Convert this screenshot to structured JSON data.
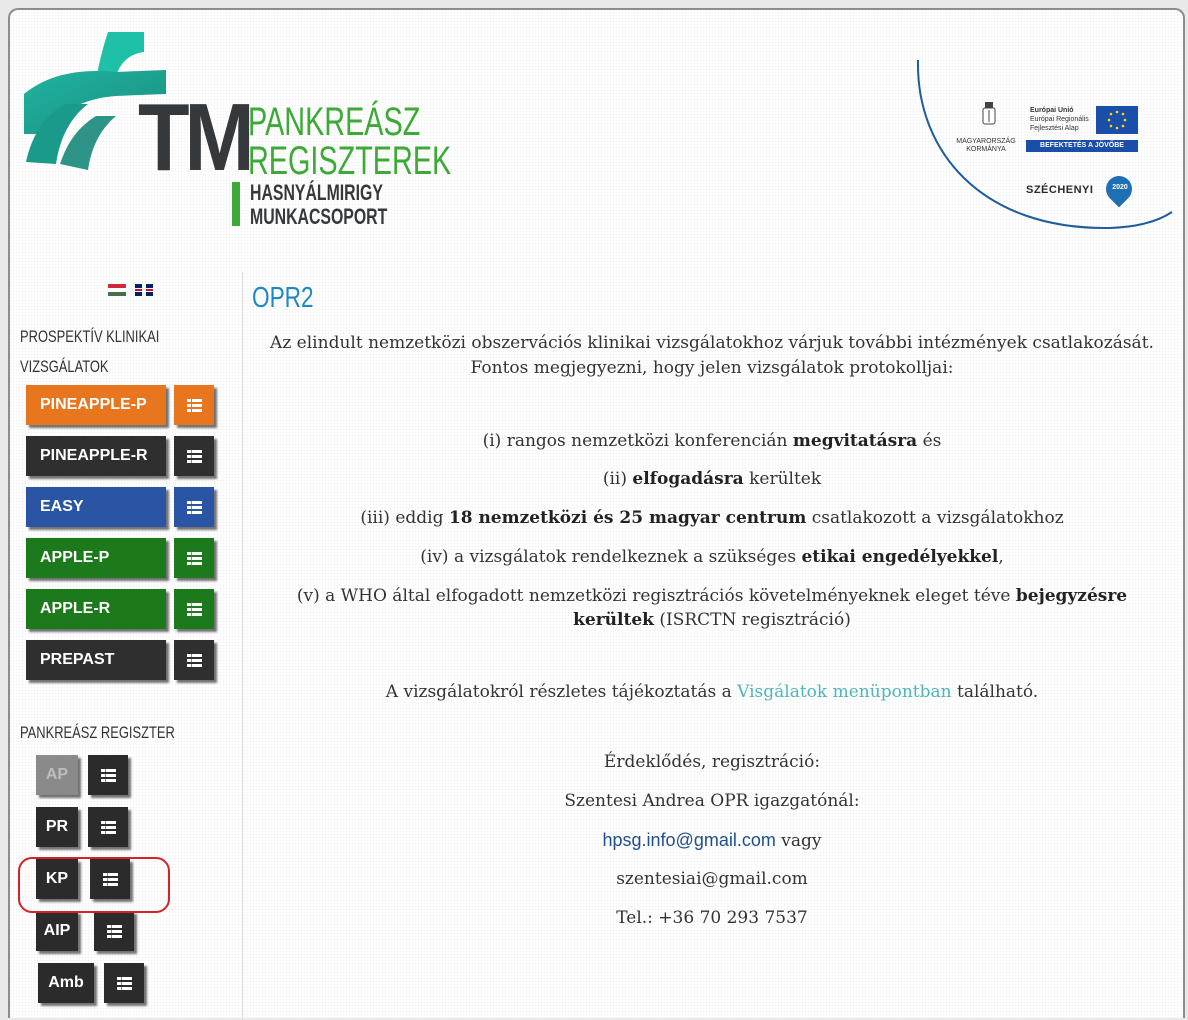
{
  "header": {
    "logo_letters": "TM",
    "logo_line1": "PANKREÁSZ",
    "logo_line2": "REGISZTEREK",
    "logo_sub1": "HASNYÁLMIRIGY",
    "logo_sub2": "MUNKACSOPORT",
    "badge": {
      "hu_text": "MAGYARORSZÁG KORMÁNYA",
      "eu_title": "Európai Unió",
      "eu_line2": "Európai Regionális",
      "eu_line3": "Fejlesztési Alap",
      "invest": "BEFEKTETÉS A JÖVŐBE",
      "szechenyi": "SZÉCHENYI",
      "year": "2020"
    }
  },
  "sidebar": {
    "section1_title_line1": "PROSPEKTÍV KLINIKAI",
    "section1_title_line2": "VIZSGÁLATOK",
    "studies": [
      {
        "label": "PINEAPPLE-P",
        "color": "#e8761f"
      },
      {
        "label": "PINEAPPLE-R",
        "color": "#2f2f2f"
      },
      {
        "label": "EASY",
        "color": "#2a55a5"
      },
      {
        "label": "APPLE-P",
        "color": "#1c7a1c"
      },
      {
        "label": "APPLE-R",
        "color": "#1c7a1c"
      },
      {
        "label": "PREPAST",
        "color": "#2f2f2f"
      }
    ],
    "section2_title": "PANKREÁSZ REGISZTER",
    "registers": [
      {
        "label": "AP"
      },
      {
        "label": "PR"
      },
      {
        "label": "KP"
      },
      {
        "label": "AIP"
      },
      {
        "label": "Amb"
      }
    ]
  },
  "main": {
    "title": "OPR2",
    "intro_line1": "Az elindult nemzetközi obszervációs klinikai vizsgálatokhoz várjuk további intézmények csatlakozását.",
    "intro_line2": "Fontos megjegyezni, hogy jelen vizsgálatok protokolljai:",
    "item1_pre": "(i) rangos nemzetközi konferencián ",
    "item1_bold": "megvitatásra",
    "item1_post": " és",
    "item2_pre": "(ii) ",
    "item2_bold": "elfogadásra",
    "item2_post": " kerültek",
    "item3_pre": "(iii) eddig ",
    "item3_bold": "18 nemzetközi és 25 magyar centrum",
    "item3_post": " csatlakozott a vizsgálatokhoz",
    "item4_pre": "(iv) a vizsgálatok rendelkeznek a szükséges ",
    "item4_bold": "etikai engedélyekkel",
    "item4_post": ",",
    "item5_pre": "(v) a WHO által elfogadott nemzetközi regisztrációs követelményeknek eleget téve ",
    "item5_bold1": "bejegyzésre",
    "item5_bold2": "kerültek",
    "item5_post": " (ISRCTN regisztráció)",
    "info_pre": "A vizsgálatokról részletes tájékoztatás a ",
    "info_link": "Visgálatok menüpontban",
    "info_post": " található.",
    "contact_title": "Érdeklődés, regisztráció:",
    "contact_name": "Szentesi Andrea OPR igazgatónál:",
    "email1": "hpsg.info@gmail.com",
    "email1_post": " vagy",
    "email2": "szentesiai@gmail.com",
    "phone": "Tel.: +36 70 293 7537"
  },
  "colors": {
    "accent_blue": "#1f88c2",
    "logo_green": "#3daa38",
    "logo_teal": "#1aa59a",
    "highlight_ring": "#d12424"
  }
}
